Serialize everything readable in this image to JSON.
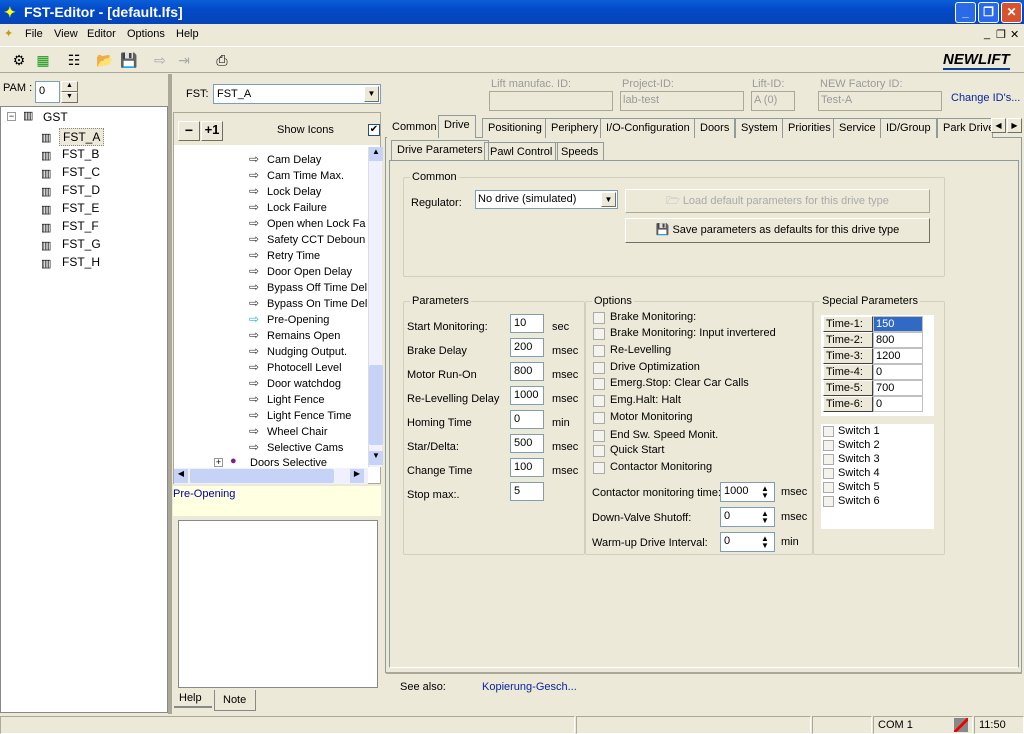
{
  "window": {
    "title": "FST-Editor   - [default.lfs]"
  },
  "menu": [
    "File",
    "View",
    "Editor",
    "Options",
    "Help"
  ],
  "toolbar": {
    "icons": [
      "settings-icon",
      "chip-icon",
      "tree-view-icon",
      "open-folder-icon",
      "save-icon",
      "export-icon",
      "import-icon",
      "print-icon"
    ],
    "logo": "NEWLIFT"
  },
  "left": {
    "pam_label": "PAM :",
    "pam_value": "0",
    "tree_root": "GST",
    "tree_items": [
      "FST_A",
      "FST_B",
      "FST_C",
      "FST_D",
      "FST_E",
      "FST_F",
      "FST_G",
      "FST_H"
    ],
    "selected": "FST_A"
  },
  "middle": {
    "fst_label": "FST:",
    "fst_value": "FST_A",
    "minus_label": "−",
    "plus_label": "+1",
    "show_icons_label": "Show Icons",
    "show_icons_checked": true,
    "tree_items": [
      "Cam Delay",
      "Cam Time Max.",
      "Lock Delay",
      "Lock Failure",
      "Open when Lock Fa",
      "Safety CCT Deboun",
      "Retry Time",
      "Door Open Delay",
      "Bypass Off Time Del",
      "Bypass On Time Del",
      "Pre-Opening",
      "Remains Open",
      "Nudging Output.",
      "Photocell Level",
      "Door watchdog",
      "Light Fence",
      "Light Fence Time",
      "Wheel Chair",
      "Selective Cams"
    ],
    "tree_parent": "Doors Selective",
    "selected": "Pre-Opening",
    "help_text": "Pre-Opening",
    "bottom_tabs": [
      "Help",
      "Note"
    ],
    "active_bottom_tab": "Note"
  },
  "ids": {
    "lift_manufac_label": "Lift manufac. ID:",
    "lift_manufac_value": "",
    "project_label": "Project-ID:",
    "project_value": "lab-test",
    "lift_label": "Lift-ID:",
    "lift_value": "A (0)",
    "factory_label": "NEW Factory ID:",
    "factory_value": "Test-A",
    "change_link": "Change ID's..."
  },
  "tabs": [
    "Common",
    "Drive",
    "Positioning",
    "Periphery",
    "I/O-Configuration",
    "Doors",
    "System",
    "Priorities",
    "Service",
    "ID/Group",
    "Park Drive"
  ],
  "active_tab": "Drive",
  "subtabs": [
    "Drive Parameters",
    "Pawl Control",
    "Speeds"
  ],
  "common": {
    "title": "Common",
    "regulator_label": "Regulator:",
    "regulator_value": "No drive (simulated)",
    "load_button": "Load default parameters for this drive type",
    "save_button": "Save parameters as defaults for this drive type"
  },
  "parameters": {
    "title": "Parameters",
    "rows": [
      {
        "label": "Start Monitoring:",
        "value": "10",
        "unit": "sec"
      },
      {
        "label": "Brake Delay",
        "value": "200",
        "unit": "msec"
      },
      {
        "label": "Motor Run-On",
        "value": "800",
        "unit": "msec"
      },
      {
        "label": "Re-Levelling Delay",
        "value": "1000",
        "unit": "msec"
      },
      {
        "label": "Homing Time",
        "value": "0",
        "unit": "min"
      },
      {
        "label": "Star/Delta:",
        "value": "500",
        "unit": "msec"
      },
      {
        "label": "Change Time",
        "value": "100",
        "unit": "msec"
      },
      {
        "label": "Stop max:.",
        "value": "5",
        "unit": ""
      }
    ]
  },
  "options": {
    "title": "Options",
    "checks": [
      "Brake Monitoring:",
      "Brake Monitoring: Input invertered",
      "Re-Levelling",
      "Drive Optimization",
      "Emerg.Stop: Clear Car Calls",
      "Emg.Halt: Halt",
      "Motor Monitoring",
      "End Sw. Speed Monit.",
      "Quick Start",
      "Contactor Monitoring"
    ],
    "spinners": [
      {
        "label": "Contactor monitoring time:",
        "value": "1000",
        "unit": "msec"
      },
      {
        "label": "Down-Valve Shutoff:",
        "value": "0",
        "unit": "msec"
      },
      {
        "label": "Warm-up Drive Interval:",
        "value": "0",
        "unit": "min"
      }
    ]
  },
  "special": {
    "title": "Special Parameters",
    "times": [
      {
        "label": "Time-1:",
        "value": "150"
      },
      {
        "label": "Time-2:",
        "value": "800"
      },
      {
        "label": "Time-3:",
        "value": "1200"
      },
      {
        "label": "Time-4:",
        "value": "0"
      },
      {
        "label": "Time-5:",
        "value": "700"
      },
      {
        "label": "Time-6:",
        "value": "0"
      }
    ],
    "switches": [
      "Switch 1",
      "Switch 2",
      "Switch 3",
      "Switch 4",
      "Switch 5",
      "Switch 6"
    ]
  },
  "see_also": {
    "label": "See also:",
    "link": "Kopierung-Gesch..."
  },
  "status": {
    "port": "COM 1",
    "time": "11:50"
  }
}
